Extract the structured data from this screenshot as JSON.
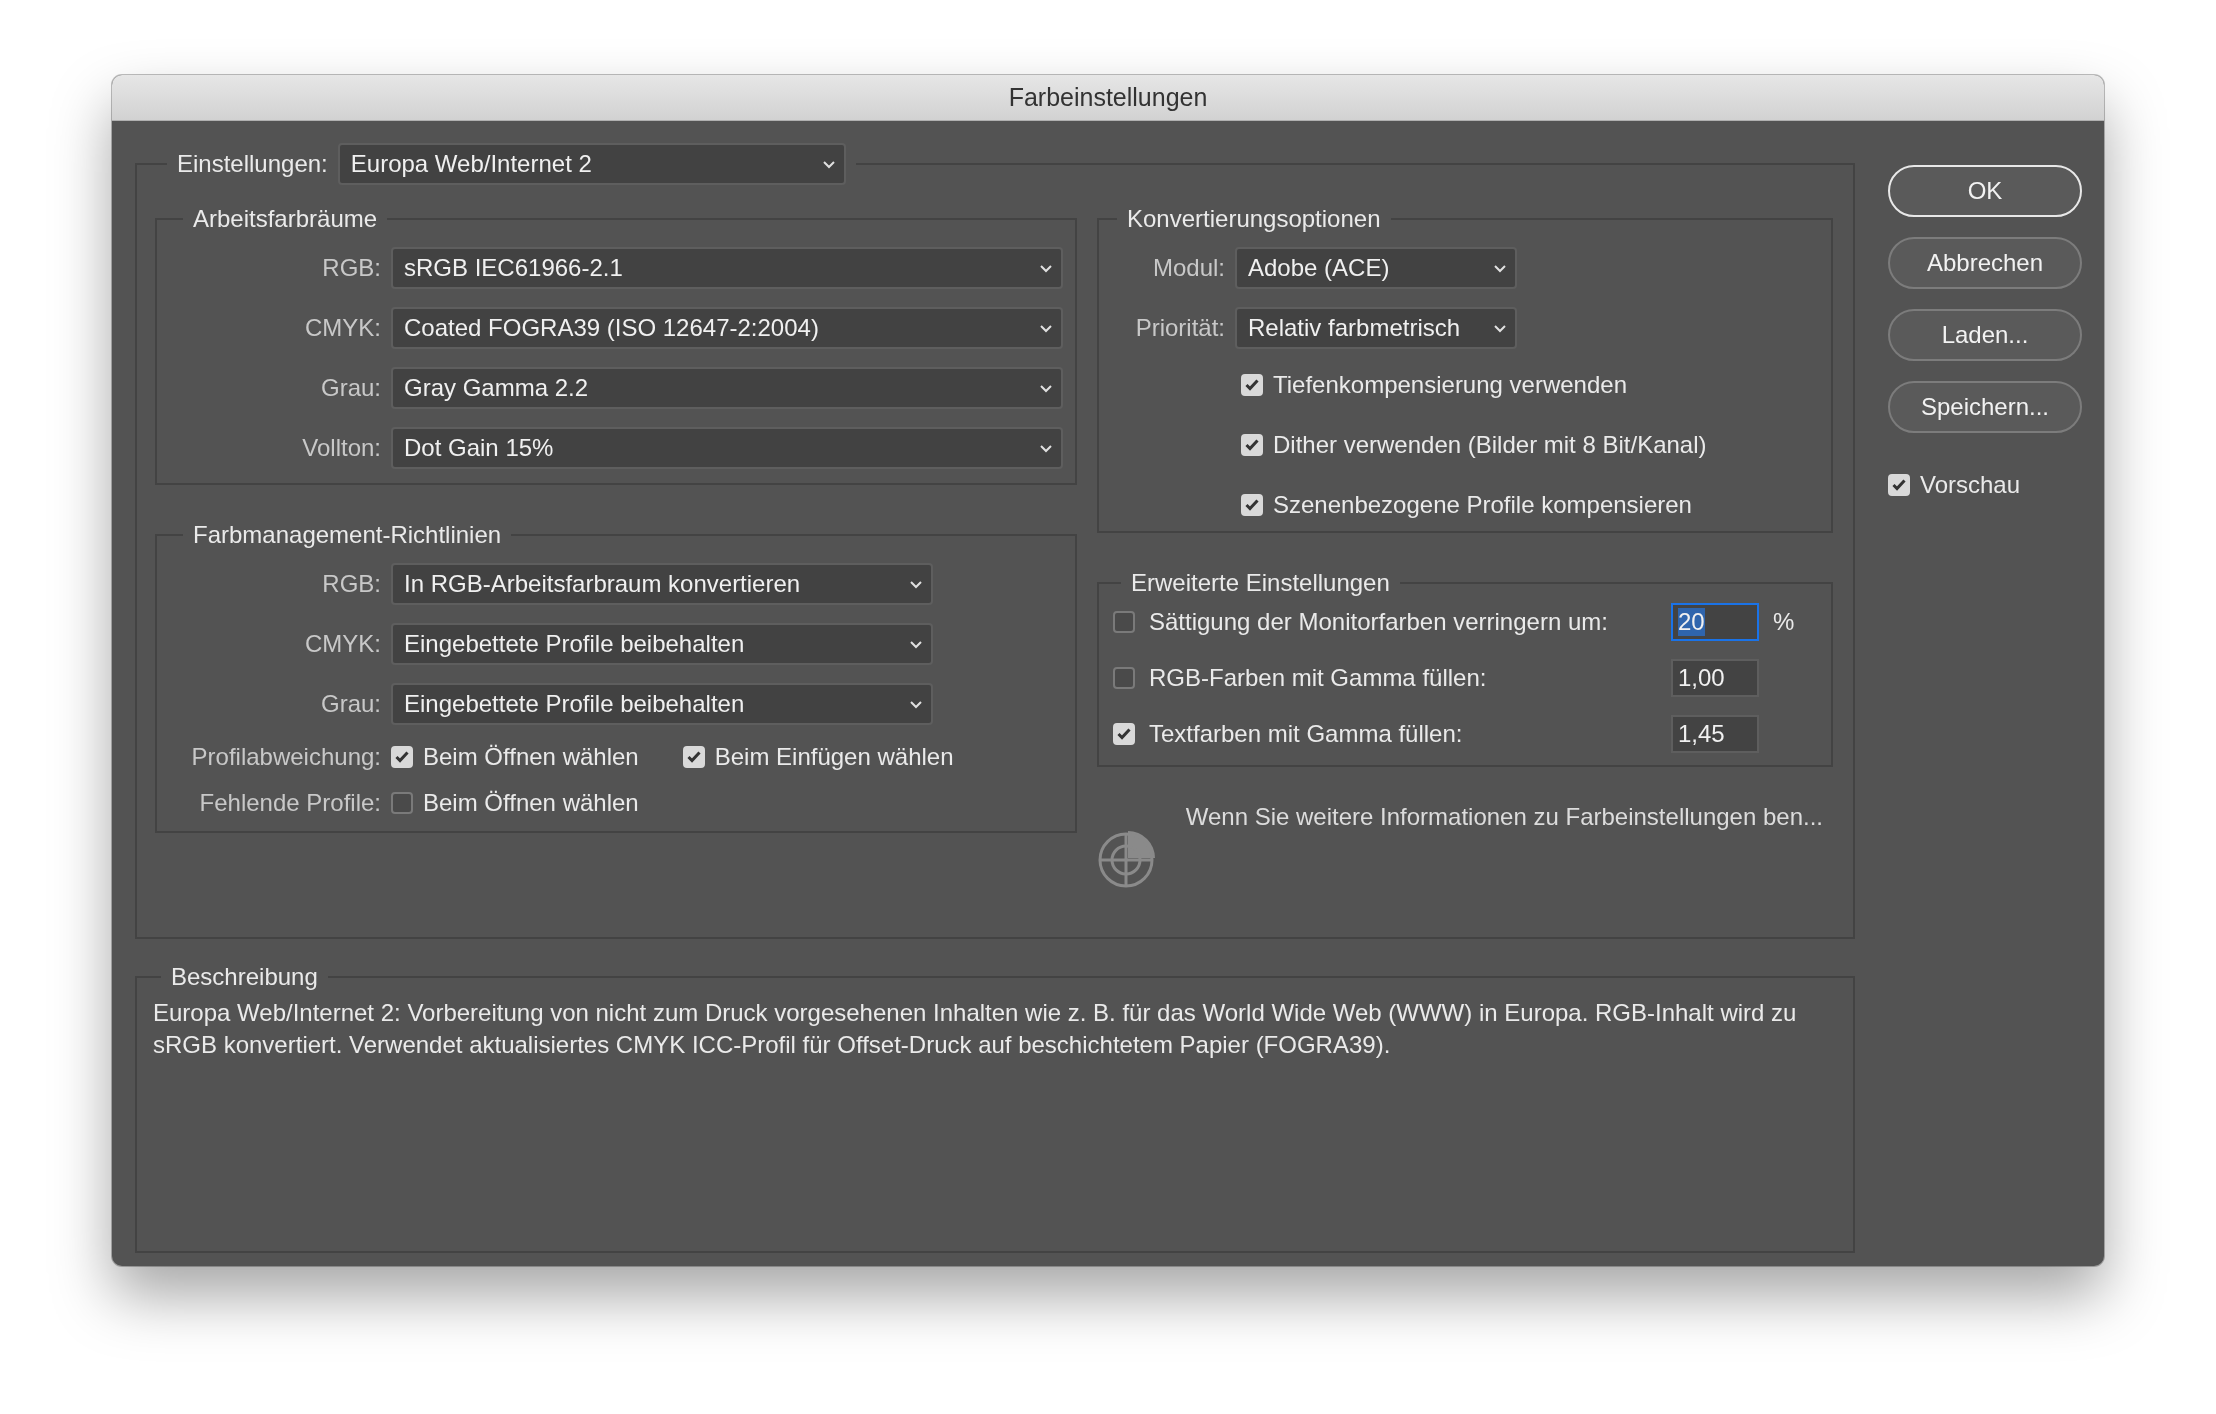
{
  "window": {
    "title": "Farbeinstellungen"
  },
  "settings": {
    "label": "Einstellungen:",
    "value": "Europa Web/Internet 2"
  },
  "working_spaces": {
    "title": "Arbeitsfarbräume",
    "rows": [
      {
        "label": "RGB:",
        "value": "sRGB IEC61966-2.1"
      },
      {
        "label": "CMYK:",
        "value": "Coated FOGRA39 (ISO 12647-2:2004)"
      },
      {
        "label": "Grau:",
        "value": "Gray Gamma 2.2"
      },
      {
        "label": "Vollton:",
        "value": "Dot Gain 15%"
      }
    ]
  },
  "policies": {
    "title": "Farbmanagement-Richtlinien",
    "rows": [
      {
        "label": "RGB:",
        "value": "In RGB-Arbeitsfarbraum konvertieren"
      },
      {
        "label": "CMYK:",
        "value": "Eingebettete Profile beibehalten"
      },
      {
        "label": "Grau:",
        "value": "Eingebettete Profile beibehalten"
      }
    ],
    "checks": [
      {
        "label": "Profilabweichung:",
        "options": [
          {
            "label": "Beim Öffnen wählen",
            "checked": true
          },
          {
            "label": "Beim Einfügen wählen",
            "checked": true
          }
        ]
      },
      {
        "label": "Fehlende Profile:",
        "options": [
          {
            "label": "Beim Öffnen wählen",
            "checked": false
          }
        ]
      }
    ]
  },
  "conversion": {
    "title": "Konvertierungsoptionen",
    "rows": [
      {
        "label": "Modul:",
        "value": "Adobe (ACE)"
      },
      {
        "label": "Priorität:",
        "value": "Relativ farbmetrisch"
      }
    ],
    "options": [
      {
        "label": "Tiefenkompensierung verwenden",
        "checked": true
      },
      {
        "label": "Dither verwenden (Bilder mit 8 Bit/Kanal)",
        "checked": true
      },
      {
        "label": "Szenenbezogene Profile kompensieren",
        "checked": true
      }
    ]
  },
  "advanced": {
    "title": "Erweiterte Einstellungen",
    "rows": [
      {
        "label": "Sättigung der Monitorfarben verringern um:",
        "checked": false,
        "value": "20",
        "focused": true,
        "unit": "%"
      },
      {
        "label": "RGB-Farben mit Gamma füllen:",
        "checked": false,
        "value": "1,00",
        "focused": false
      },
      {
        "label": "Textfarben mit Gamma füllen:",
        "checked": true,
        "value": "1,45",
        "focused": false
      }
    ]
  },
  "info_text": "Wenn Sie weitere Informationen zu Farbeinstellungen ben...",
  "buttons": [
    {
      "label": "OK",
      "default": true
    },
    {
      "label": "Abbrechen",
      "default": false
    },
    {
      "label": "Laden...",
      "default": false
    },
    {
      "label": "Speichern...",
      "default": false
    }
  ],
  "preview": {
    "label": "Vorschau",
    "checked": true
  },
  "description": {
    "title": "Beschreibung",
    "text": "Europa Web/Internet 2:  Vorbereitung von nicht zum Druck vorgesehenen Inhalten wie z. B. für das World Wide Web (WWW) in Europa. RGB-Inhalt wird zu sRGB konvertiert. Verwendet aktualisiertes CMYK ICC-Profil für Offset-Druck auf beschichtetem Papier (FOGRA39)."
  }
}
